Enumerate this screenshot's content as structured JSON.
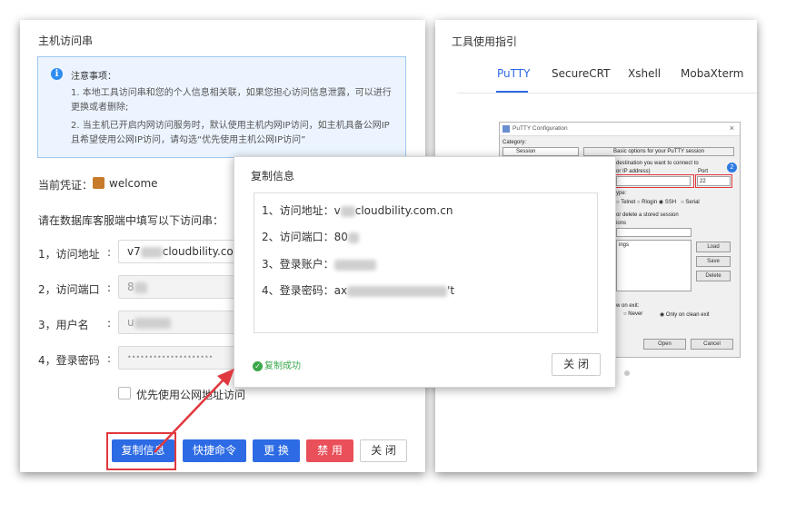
{
  "left": {
    "title": "主机访问串",
    "notice": {
      "title": "注意事项：",
      "p1": "1. 本地工具访问串和您的个人信息相关联，如果您担心访问信息泄露，可以进行更换或者删除;",
      "p2": "2. 当主机已开启内网访问服务时，默认使用主机内网IP访问，如主机具备公网IP且希望使用公网IP访问，请勾选“优先使用主机公网IP访问”"
    },
    "credential_label": "当前凭证：",
    "credential_value": "welcome",
    "instruction": "请在数据库客服端中填写以下访问串：",
    "rows": [
      {
        "label": "1，访问地址",
        "value_prefix": "v7",
        "value_suffix": "cloudbility.com"
      },
      {
        "label": "2，访问端口",
        "value_prefix": "8",
        "value_suffix": ""
      },
      {
        "label": "3，用户名",
        "value_prefix": "u",
        "value_suffix": ""
      },
      {
        "label": "4，登录密码",
        "value_prefix": "••••••••••••••••••••",
        "value_suffix": ""
      }
    ],
    "checkbox_label": "优先使用公网地址访问",
    "buttons": {
      "copy": "复制信息",
      "quick": "快捷命令",
      "change": "更 换",
      "disable": "禁 用",
      "close": "关 闭"
    }
  },
  "right": {
    "title": "工具使用指引",
    "tabs": [
      "PuTTY",
      "SecureCRT",
      "Xshell",
      "MobaXterm"
    ],
    "active_tab": 0,
    "putty": {
      "title": "PuTTY Configuration",
      "category": "Category:",
      "session": "Session",
      "header": "Basic options for your PuTTY session",
      "dest": "destination you want to connect to",
      "host_label": "or IP address)",
      "port_label": "Port",
      "port_value": "22",
      "badge": "2",
      "type_label": "ype:",
      "radios": [
        "Telnet",
        "Rlogin",
        "SSH",
        "Serial"
      ],
      "saved_label": "or delete a stored session",
      "sessions_label": "ions",
      "settings_item": "ings",
      "load": "Load",
      "save": "Save",
      "delete": "Delete",
      "exit_label": "w on exit:",
      "exit_never": "Never",
      "exit_clean": "Only on clean exit",
      "open": "Open",
      "cancel": "Cancel"
    }
  },
  "dialog": {
    "title": "复制信息",
    "lines": [
      {
        "label": "1、访问地址：",
        "prefix": "v",
        "suffix": "cloudbility.com.cn"
      },
      {
        "label": "2、访问端口：",
        "prefix": "80",
        "suffix": ""
      },
      {
        "label": "3、登录账户：",
        "prefix": "",
        "suffix": ""
      },
      {
        "label": "4、登录密码：",
        "prefix": "ax",
        "suffix": "'t"
      }
    ],
    "success": "复制成功",
    "close": "关 闭"
  },
  "colors": {
    "primary": "#2d6be4",
    "danger": "#e9505a",
    "success": "#3aa84b",
    "annotation": "#e0383e"
  }
}
